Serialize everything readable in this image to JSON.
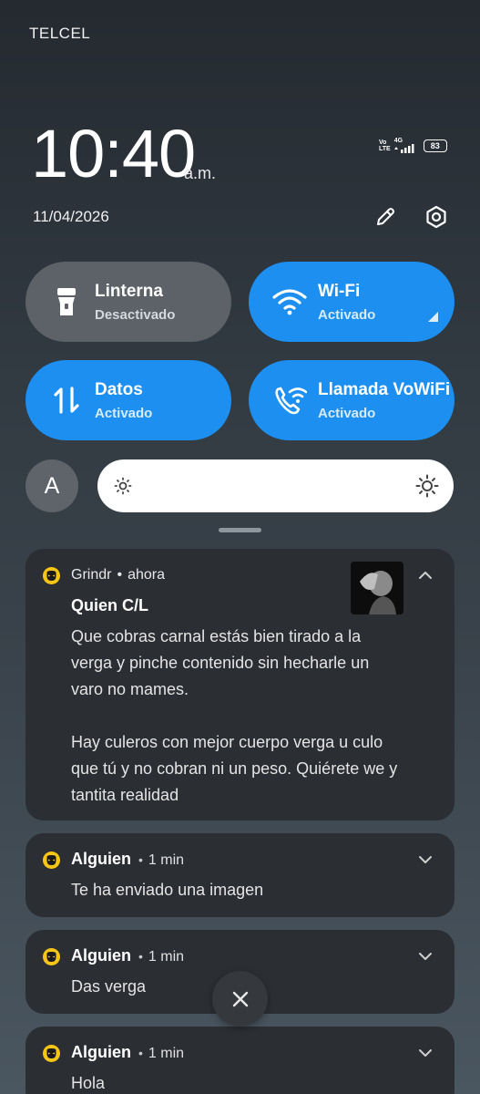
{
  "status_bar": {
    "carrier": "TELCEL",
    "volte": "Vo LTE",
    "network": "4G",
    "battery": "83"
  },
  "header": {
    "time": "10:40",
    "ampm": "a.m.",
    "date": "11/04/2026"
  },
  "tiles": [
    {
      "title": "Linterna",
      "status": "Desactivado",
      "icon": "flashlight-icon",
      "state": "off"
    },
    {
      "title": "Wi-Fi",
      "status": "Activado",
      "icon": "wifi-icon",
      "state": "on"
    },
    {
      "title": "Datos",
      "status": "Activado",
      "icon": "data-arrows-icon",
      "state": "on"
    },
    {
      "title": "Llamada VoWiFi",
      "status": "Activado",
      "icon": "wifi-call-icon",
      "state": "on"
    }
  ],
  "brightness": {
    "auto_label": "A"
  },
  "colors": {
    "accent": "#1d8ff0",
    "tile_off": "#5d6269",
    "card": "#2b2e33",
    "grindr": "#f5c518"
  },
  "notifications": [
    {
      "app": "Grindr",
      "time": "ahora",
      "title": "Quien C/L",
      "body_lines": [
        "Que cobras carnal estás bien tirado a la",
        "verga y pinche contenido sin hecharle un",
        "varo no mames.",
        "",
        "Hay culeros con mejor cuerpo verga u culo",
        "que tú y no cobran ni un peso. Quiérete we y",
        "tantita realidad"
      ]
    },
    {
      "sender": "Alguien",
      "time": "1 min",
      "body": "Te ha enviado una imagen"
    },
    {
      "sender": "Alguien",
      "time": "1 min",
      "body": "Das verga"
    },
    {
      "sender": "Alguien",
      "time": "1 min",
      "body": "Hola"
    }
  ],
  "separator": "•"
}
